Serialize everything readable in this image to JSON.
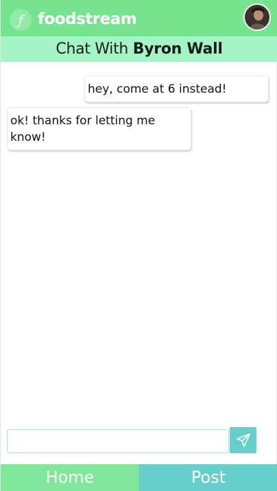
{
  "header": {
    "logo_glyph": "ƒ",
    "brand": "foodstream"
  },
  "chat": {
    "title_prefix": "Chat With ",
    "contact_name": "Byron Wall"
  },
  "messages": [
    {
      "direction": "outgoing",
      "text": "hey, come at 6 instead!"
    },
    {
      "direction": "incoming",
      "text": "ok! thanks for letting me know!"
    }
  ],
  "composer": {
    "value": "",
    "placeholder": ""
  },
  "nav": {
    "home_label": "Home",
    "post_label": "Post"
  },
  "colors": {
    "header_green": "#76e38e",
    "title_bar_mint": "#a3f5c6",
    "teal": "#67cfca",
    "home_green": "#80e69a"
  },
  "icons": {
    "logo": "logo-icon",
    "avatar": "user-avatar",
    "send": "paper-plane-icon"
  }
}
